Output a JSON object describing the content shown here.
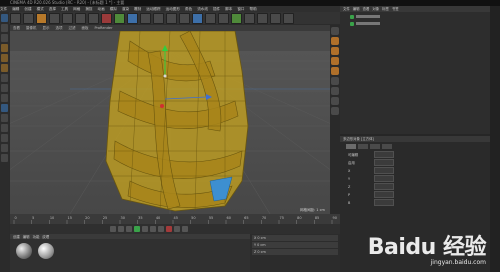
{
  "window": {
    "title": "CINEMA 4D R20.026 Studio (RC - R20) - [未标题 1 *] - 主要"
  },
  "menu": {
    "items": [
      "文件",
      "编辑",
      "创建",
      "模式",
      "选择",
      "工具",
      "网格",
      "捕捉",
      "动画",
      "模拟",
      "渲染",
      "雕刻",
      "运动跟踪",
      "运动图形",
      "角色",
      "流水线",
      "插件",
      "脚本",
      "窗口",
      "帮助"
    ]
  },
  "viewport": {
    "menu": [
      "查看",
      "摄像机",
      "显示",
      "选项",
      "过滤",
      "面板",
      "ProRender"
    ],
    "label": "透视视图"
  },
  "timeline": {
    "ticks": [
      "0",
      "5",
      "10",
      "15",
      "20",
      "25",
      "30",
      "35",
      "40",
      "45",
      "50",
      "55",
      "60",
      "65",
      "70",
      "75",
      "80",
      "85",
      "90"
    ],
    "frame_readout": "网格间距: 1 cm"
  },
  "material_manager": {
    "menu": [
      "创建",
      "编辑",
      "功能",
      "纹理"
    ]
  },
  "coordinates": {
    "rows": [
      "X 0 cm",
      "Y 0 cm",
      "Z 0 cm"
    ]
  },
  "object_manager": {
    "menu": [
      "文件",
      "编辑",
      "查看",
      "对象",
      "标签",
      "书签"
    ]
  },
  "attribute_manager": {
    "header": "多边形对象 [立方体]",
    "rows": [
      "可编辑",
      "启用",
      "X",
      "Y",
      "Z",
      "P",
      "B"
    ]
  },
  "watermark": {
    "text": "Baidu 经验",
    "sub": "jingyan.baidu.com"
  },
  "colors": {
    "mesh_fill": "#c9a51e",
    "mesh_line": "#6a560e",
    "selection": "#3d8fd0"
  }
}
